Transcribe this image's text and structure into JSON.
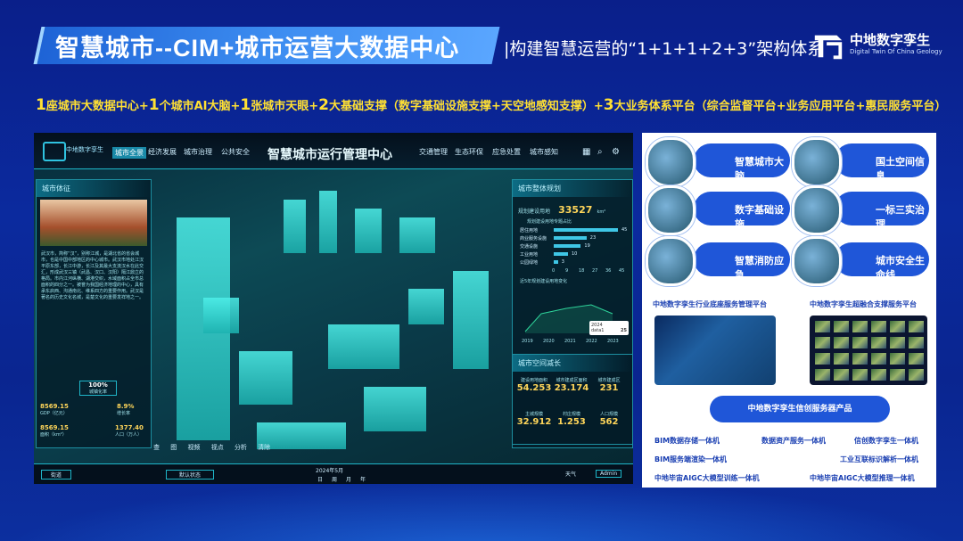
{
  "header": {
    "title": "智慧城市--CIM+城市运营大数据中心",
    "subtitle": "|构建智慧运营的“1+1+1+2+3”架构体系",
    "brand_name": "中地数字孪生",
    "brand_sub": "Digital Twin Of China Geology"
  },
  "banner": {
    "p1n": "1",
    "p1": "座城市大数据中心+",
    "p2n": "1",
    "p2": "个城市AI大脑+",
    "p3n": "1",
    "p3": "张城市天眼+",
    "p4n": "2",
    "p4": "大基础支撑（数字基础设施支撑+天空地感知支撑）+",
    "p5n": "3",
    "p5": "大业务体系平台（综合监督平台+业务应用平台+惠民服务平台）"
  },
  "screen": {
    "brand": "中地数字孪生",
    "title": "智慧城市运行管理中心",
    "nav_left": [
      "城市全景",
      "经济发展",
      "城市治理",
      "公共安全"
    ],
    "nav_right": [
      "交通管理",
      "生态环保",
      "应急处置",
      "城市感知"
    ],
    "left_panel": {
      "title": "城市体征",
      "desc": "武汉市，简称“汉”，别称江城，是湖北省的省会城市，也是中国中部地区的中心城市。武汉市地处江汉平原东部，长江中游，长江及其最大支流汉水在此交汇，形成武汉三镇（武昌、汉口、汉阳）隔江鼎立的格局。市内江河纵横、湖港交织，水域面积占全市总面积的四分之一。被誉为我国经济地理的中心，具有承东启西、沟通南北、维系四方的重要作用。武汉是著名的历史文化名城，是楚文化的重要发祥地之一。",
      "pct": "100%",
      "pct_label": "城镇化率",
      "s1": "8569.15",
      "s1l": "GDP（亿元）",
      "s2": "8.9%",
      "s2l": "增长率",
      "s3": "8569.15",
      "s3l": "面积（km²）",
      "s4": "1377.40",
      "s4l": "人口（万人）"
    },
    "right_panel": {
      "title": "城市整体规划",
      "metric_label": "规划建设用地",
      "metric_value": "33527",
      "metric_unit": "km²",
      "dist_title": "规划建设用地专题占比",
      "bars": [
        {
          "label": "居住用地",
          "value": 45
        },
        {
          "label": "商业服务设施",
          "value": 23
        },
        {
          "label": "交通设施",
          "value": 19
        },
        {
          "label": "工业用地",
          "value": 10
        },
        {
          "label": "公园绿地",
          "value": 3
        }
      ],
      "axis": [
        "0",
        "9",
        "18",
        "27",
        "36",
        "45"
      ],
      "trend_title": "近5年规划建设用地变化",
      "trend_years": [
        "2019",
        "2020",
        "2021",
        "2022",
        "2023"
      ],
      "tooltip_year": "2024",
      "tooltip_label": "data1",
      "tooltip_value": "25",
      "growth_title": "城市空间减长",
      "stats": [
        {
          "value": "54.253",
          "label": "建设用地面积"
        },
        {
          "value": "23.174",
          "label": "城市建成区面积"
        },
        {
          "value": "231",
          "label": "城市建成区"
        },
        {
          "value": "32.912",
          "label": "主城规模"
        },
        {
          "value": "1.253",
          "label": "村庄规模"
        },
        {
          "value": "562",
          "label": "人口规模"
        }
      ]
    },
    "bottom": {
      "left_select": "街道",
      "state_select": "默认状态",
      "date": "2024年5月",
      "date_tabs": [
        "日",
        "周",
        "月",
        "年"
      ],
      "weather": "天气",
      "user": "Admin"
    },
    "toolbar": [
      "查",
      "图",
      "视频",
      "视点",
      "分析",
      "清除"
    ]
  },
  "right": {
    "cards": [
      "智慧城市大脑",
      "国土空间信息",
      "数字基础设施",
      "一标三实治理",
      "智慧消防应急",
      "城市安全生命线"
    ],
    "platform1": "中地数字孪生行业底座服务管理平台",
    "platform2": "中地数字孪生超融合支撑服务平台",
    "server_title": "中地数字孪生信创服务器产品",
    "products": [
      "BIM数据存储一体机",
      "数据资产服务一体机",
      "信创数字孪生一体机",
      "BIM服务端渲染一体机",
      "工业互联标识解析一体机",
      "中地毕宙AIGC大模型训练一体机",
      "中地毕宙AIGC大模型推理一体机"
    ]
  }
}
